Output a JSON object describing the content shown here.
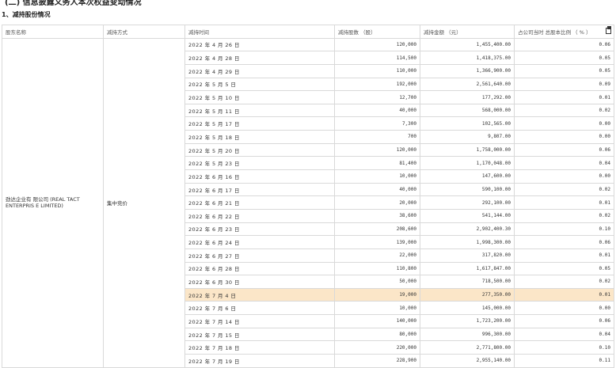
{
  "doc": {
    "heading_clipped": "(二) 信息披露义务人本次权益变动情况",
    "section_title": "1、减持股份情况"
  },
  "table": {
    "headers": [
      "股东名称",
      "减持方式",
      "减持时间",
      "减持股数 （股）",
      "减持金额 （元）",
      "占公司当时 总股本比例 （ % ）"
    ],
    "holder": "劲达企业有 限公司 (REAL TACT ENTERPRIS E LIMITED)",
    "method": "集中竞价",
    "highlight_row_index": 19,
    "rows": [
      {
        "date": "2022 年 4 月 26 日",
        "shares": "120,000",
        "amount": "1,455,400.00",
        "ratio": "0.06"
      },
      {
        "date": "2022 年 4 月 28 日",
        "shares": "114,500",
        "amount": "1,418,375.00",
        "ratio": "0.05"
      },
      {
        "date": "2022 年 4 月 29 日",
        "shares": "110,000",
        "amount": "1,366,900.00",
        "ratio": "0.05"
      },
      {
        "date": "2022 年 5 月 5 日",
        "shares": "192,000",
        "amount": "2,561,640.00",
        "ratio": "0.09"
      },
      {
        "date": "2022 年 5 月 10 日",
        "shares": "12,700",
        "amount": "177,292.00",
        "ratio": "0.01"
      },
      {
        "date": "2022 年 5 月 11 日",
        "shares": "40,000",
        "amount": "568,000.00",
        "ratio": "0.02"
      },
      {
        "date": "2022 年 5 月 17 日",
        "shares": "7,300",
        "amount": "102,565.00",
        "ratio": "0.00"
      },
      {
        "date": "2022 年 5 月 18 日",
        "shares": "700",
        "amount": "9,807.00",
        "ratio": "0.00"
      },
      {
        "date": "2022 年 5 月 20 日",
        "shares": "120,000",
        "amount": "1,758,000.00",
        "ratio": "0.06"
      },
      {
        "date": "2022 年 5 月 23 日",
        "shares": "81,400",
        "amount": "1,170,048.00",
        "ratio": "0.04"
      },
      {
        "date": "2022 年 6 月 16 日",
        "shares": "10,000",
        "amount": "147,600.00",
        "ratio": "0.00"
      },
      {
        "date": "2022 年 6 月 17 日",
        "shares": "40,000",
        "amount": "590,100.00",
        "ratio": "0.02"
      },
      {
        "date": "2022 年 6 月 21 日",
        "shares": "20,000",
        "amount": "292,100.00",
        "ratio": "0.01"
      },
      {
        "date": "2022 年 6 月 22 日",
        "shares": "38,600",
        "amount": "541,144.00",
        "ratio": "0.02"
      },
      {
        "date": "2022 年 6 月 23 日",
        "shares": "208,600",
        "amount": "2,902,400.30",
        "ratio": "0.10"
      },
      {
        "date": "2022 年 6 月 24 日",
        "shares": "139,000",
        "amount": "1,998,300.00",
        "ratio": "0.06"
      },
      {
        "date": "2022 年 6 月 27 日",
        "shares": "22,000",
        "amount": "317,820.00",
        "ratio": "0.01"
      },
      {
        "date": "2022 年 6 月 28 日",
        "shares": "110,800",
        "amount": "1,617,847.00",
        "ratio": "0.05"
      },
      {
        "date": "2022 年 6 月 30 日",
        "shares": "50,000",
        "amount": "718,500.00",
        "ratio": "0.02"
      },
      {
        "date": "2022 年 7 月 4 日",
        "shares": "19,000",
        "amount": "277,350.00",
        "ratio": "0.01"
      },
      {
        "date": "2022 年 7 月 6 日",
        "shares": "10,000",
        "amount": "145,000.00",
        "ratio": "0.00"
      },
      {
        "date": "2022 年 7 月 14 日",
        "shares": "140,000",
        "amount": "1,723,200.00",
        "ratio": "0.06"
      },
      {
        "date": "2022 年 7 月 15 日",
        "shares": "80,000",
        "amount": "996,300.00",
        "ratio": "0.04"
      },
      {
        "date": "2022 年 7 月 18 日",
        "shares": "220,000",
        "amount": "2,771,800.00",
        "ratio": "0.10"
      },
      {
        "date": "2022 年 7 月 19 日",
        "shares": "228,900",
        "amount": "2,955,140.00",
        "ratio": "0.11"
      }
    ]
  },
  "icons": {
    "export": "export-icon"
  },
  "colors": {
    "highlight_row": "#fbe6c8",
    "grid_line": "#d9d9d9"
  }
}
